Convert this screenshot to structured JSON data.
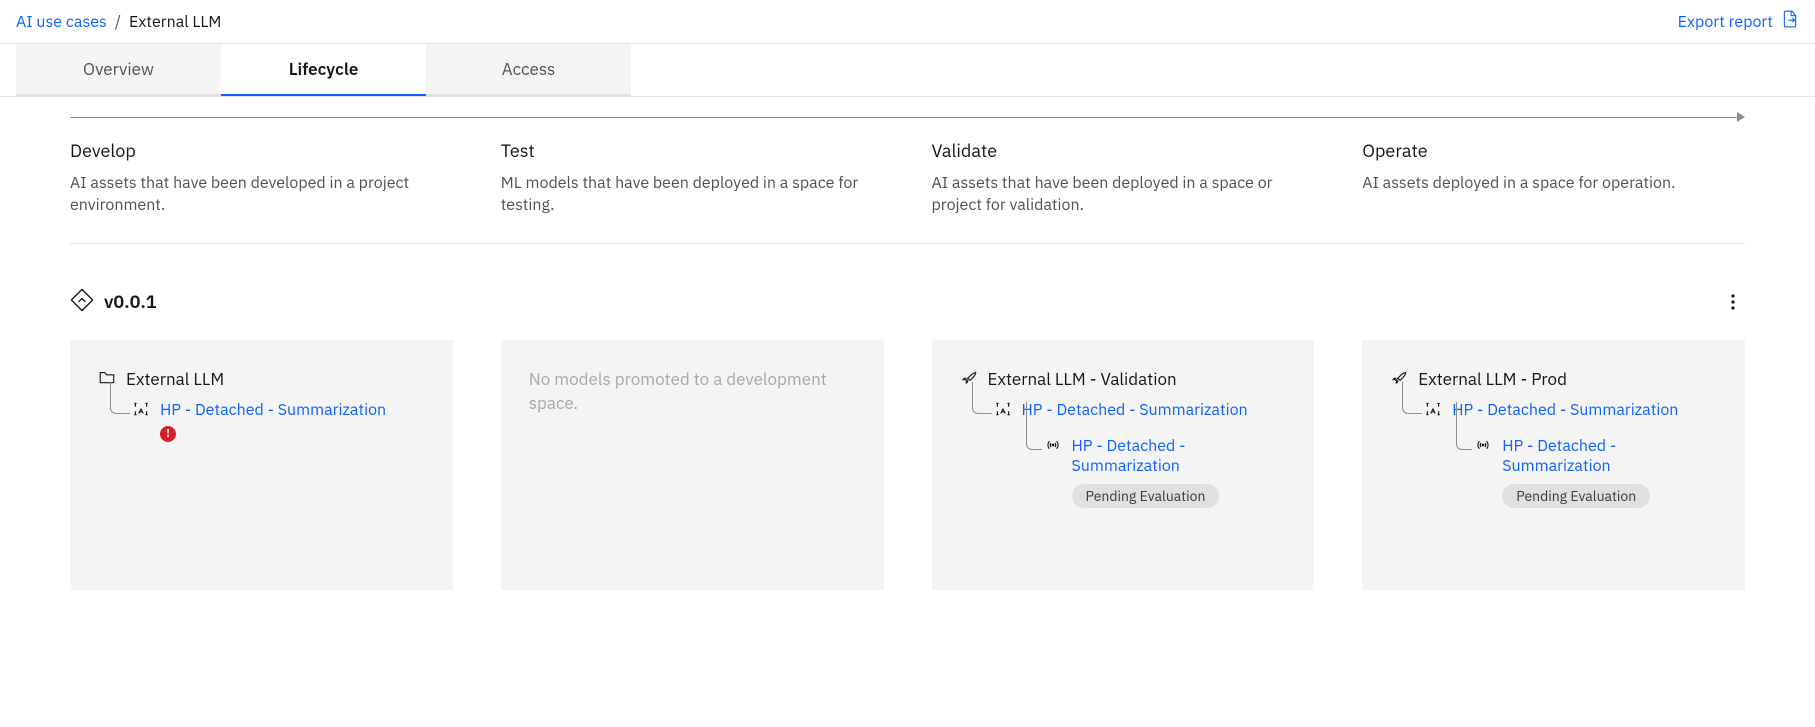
{
  "breadcrumb": {
    "parent": "AI use cases",
    "current": "External LLM"
  },
  "export_label": "Export report",
  "tabs": {
    "overview": "Overview",
    "lifecycle": "Lifecycle",
    "access": "Access"
  },
  "stages": {
    "develop": {
      "title": "Develop",
      "desc": "AI assets that have been developed in a project environment."
    },
    "test": {
      "title": "Test",
      "desc": "ML models that have been deployed in a space for testing."
    },
    "validate": {
      "title": "Validate",
      "desc": "AI assets that have been deployed in a space or project for validation."
    },
    "operate": {
      "title": "Operate",
      "desc": "AI assets deployed in a space for operation."
    }
  },
  "version": "v0.0.1",
  "cards": {
    "develop": {
      "container_title": "External LLM",
      "asset_name": "HP - Detached - Summarization"
    },
    "test": {
      "placeholder": "No models promoted to a development space."
    },
    "validate": {
      "container_title": "External LLM - Validation",
      "asset_name": "HP - Detached - Summarization",
      "nested_asset_name": "HP - Detached - Summarization",
      "badge": "Pending Evaluation"
    },
    "operate": {
      "container_title": "External LLM - Prod",
      "asset_name": "HP - Detached - Summarization",
      "nested_asset_name": "HP - Detached - Summarization",
      "badge": "Pending Evaluation"
    }
  }
}
